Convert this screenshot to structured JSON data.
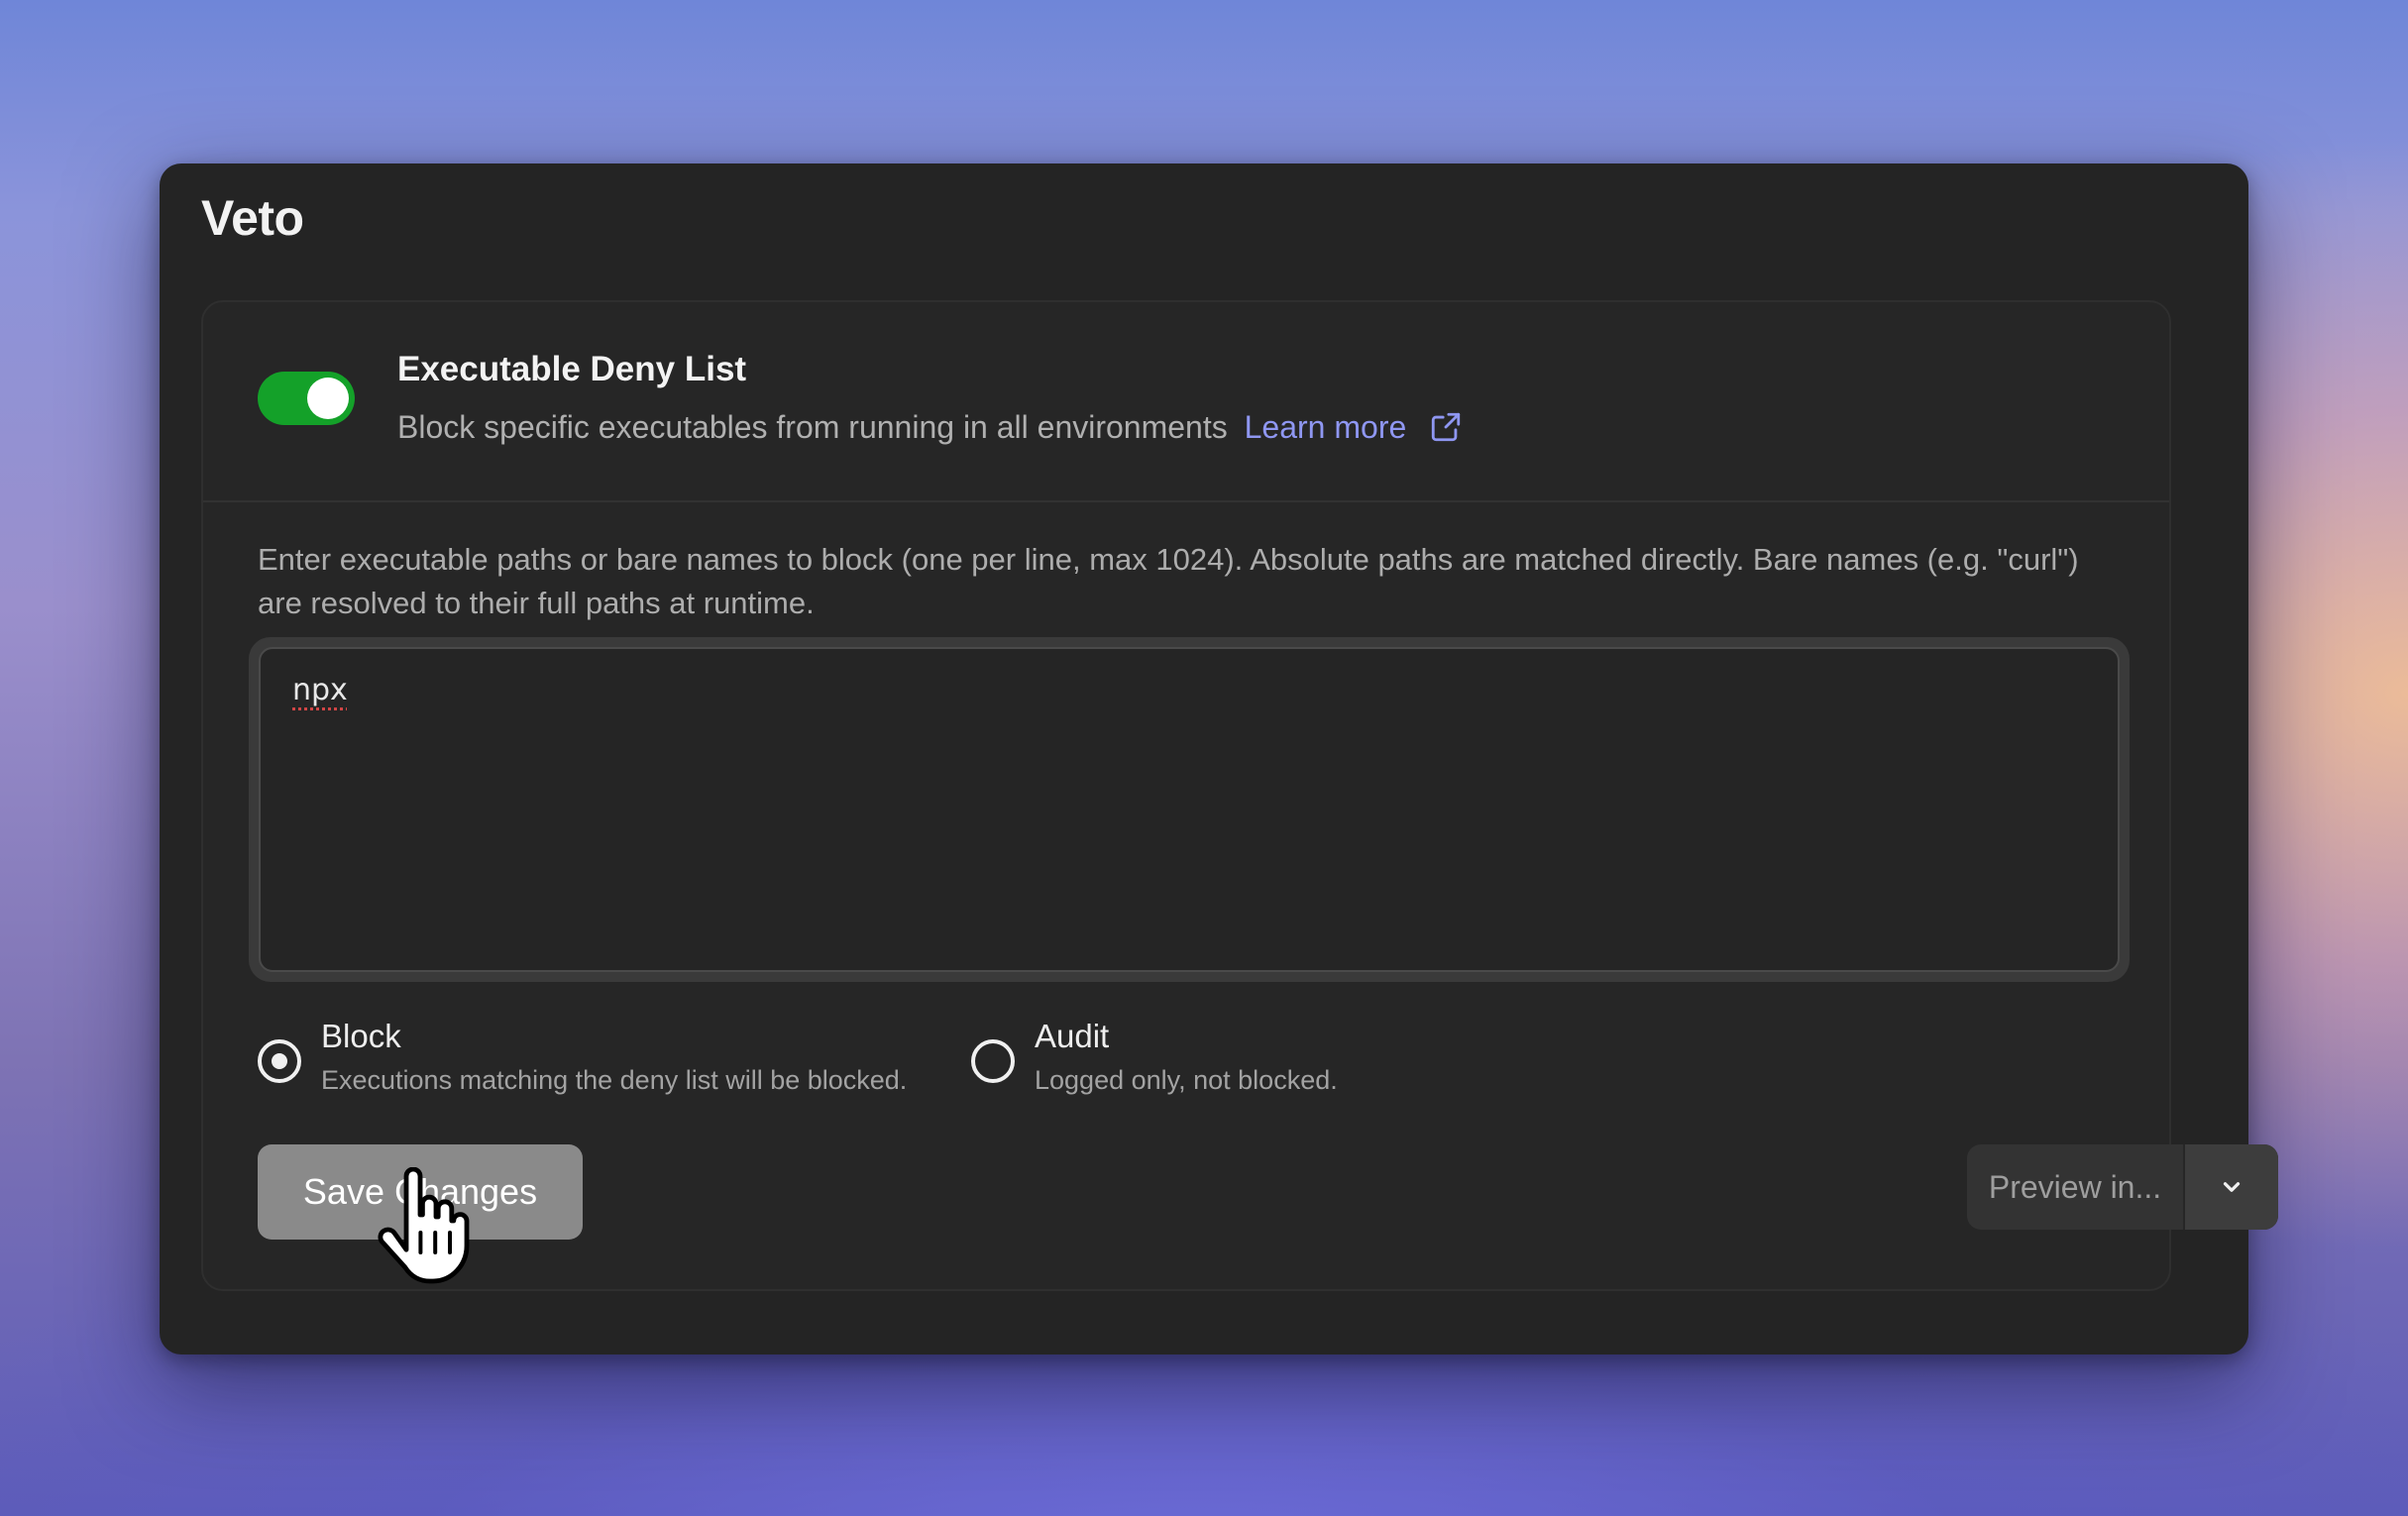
{
  "app": {
    "title": "Veto"
  },
  "feature": {
    "title": "Executable Deny List",
    "description": "Block specific executables from running in all environments",
    "learn_more_label": "Learn more",
    "enabled": true,
    "toggle_color": "#14a129"
  },
  "deny_list": {
    "instructions": "Enter executable paths or bare names to block (one per line, max 1024). Absolute paths are matched directly. Bare names (e.g. \"curl\") are resolved to their full paths at runtime.",
    "value": "npx"
  },
  "mode": {
    "selected": "block",
    "options": [
      {
        "id": "block",
        "label": "Block",
        "description": "Executions matching the deny list will be blocked."
      },
      {
        "id": "audit",
        "label": "Audit",
        "description": "Logged only, not blocked."
      }
    ]
  },
  "actions": {
    "save_label": "Save Changes",
    "preview_label": "Preview in..."
  },
  "icons": {
    "learn_more": "external-link-icon",
    "preview_dropdown": "chevron-down-icon",
    "cursor": "hand-pointer-icon"
  },
  "colors": {
    "link": "#8f97f2",
    "window_bg": "#242424"
  }
}
